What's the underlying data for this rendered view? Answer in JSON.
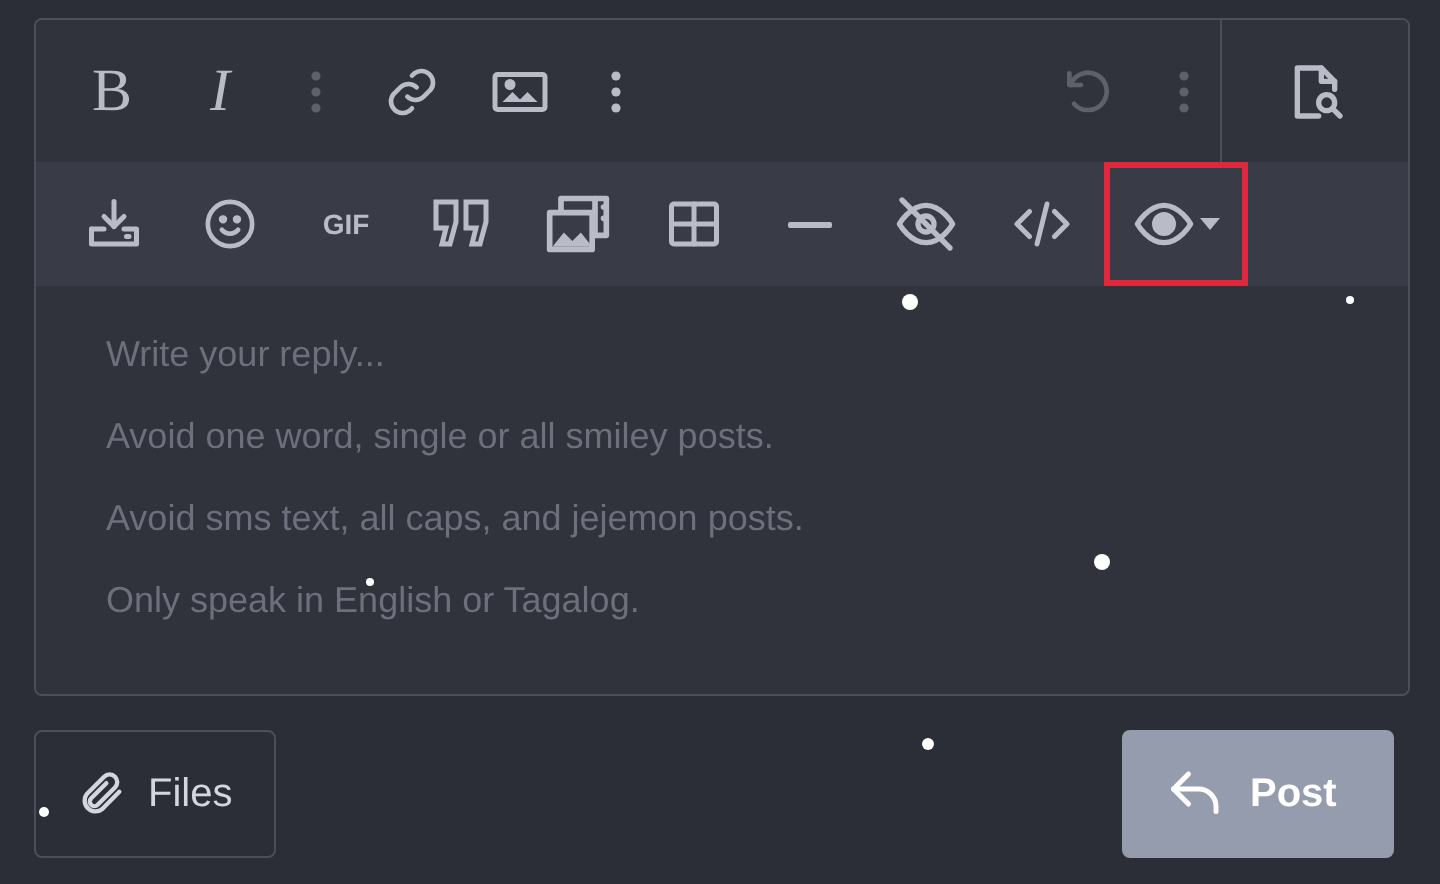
{
  "toolbar_top": [
    {
      "kind": "bold",
      "text": "B",
      "disabled": false
    },
    {
      "kind": "italic",
      "text": "I",
      "disabled": false
    },
    {
      "kind": "more",
      "disabled": true
    },
    {
      "kind": "link",
      "disabled": false
    },
    {
      "kind": "image",
      "disabled": false
    },
    {
      "kind": "more",
      "disabled": false
    },
    {
      "kind": "spacer"
    },
    {
      "kind": "undo",
      "disabled": true
    },
    {
      "kind": "more",
      "disabled": true
    }
  ],
  "preview_button": {
    "kind": "preview"
  },
  "toolbar_bottom": [
    {
      "kind": "insert",
      "highlighted": false
    },
    {
      "kind": "smiley",
      "highlighted": false
    },
    {
      "kind": "gif",
      "text": "GIF",
      "highlighted": false
    },
    {
      "kind": "quote",
      "highlighted": false
    },
    {
      "kind": "gallery",
      "highlighted": false
    },
    {
      "kind": "table",
      "highlighted": false
    },
    {
      "kind": "rule",
      "highlighted": false
    },
    {
      "kind": "hide",
      "highlighted": false
    },
    {
      "kind": "code",
      "highlighted": false
    },
    {
      "kind": "view",
      "highlighted": true
    }
  ],
  "editor": {
    "placeholder": "Write your reply...\nAvoid one word, single or all smiley posts.\nAvoid sms text, all caps, and jejemon posts.\nOnly speak in English or Tagalog."
  },
  "files_button": {
    "label": "Files"
  },
  "post_button": {
    "label": "Post"
  }
}
